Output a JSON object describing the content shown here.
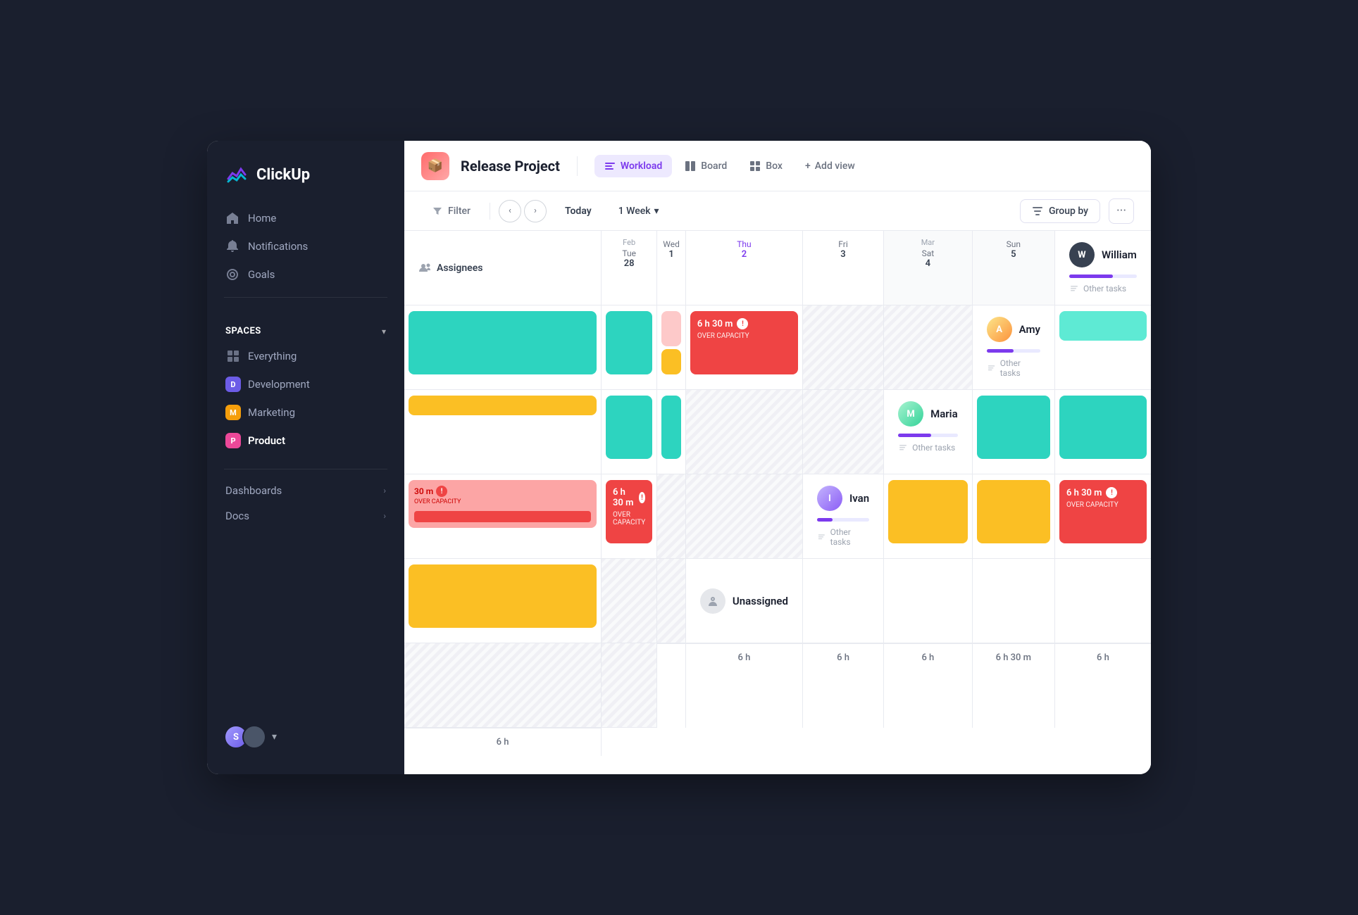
{
  "app": {
    "name": "ClickUp"
  },
  "sidebar": {
    "nav": [
      {
        "id": "home",
        "label": "Home",
        "icon": "home"
      },
      {
        "id": "notifications",
        "label": "Notifications",
        "icon": "bell"
      },
      {
        "id": "goals",
        "label": "Goals",
        "icon": "trophy"
      }
    ],
    "spaces_label": "Spaces",
    "spaces": [
      {
        "id": "everything",
        "label": "Everything",
        "icon": "grid",
        "badge": null
      },
      {
        "id": "development",
        "label": "Development",
        "badge": "D",
        "color": "#6c5ce7"
      },
      {
        "id": "marketing",
        "label": "Marketing",
        "badge": "M",
        "color": "#f59e0b"
      },
      {
        "id": "product",
        "label": "Product",
        "badge": "P",
        "color": "#ec4899",
        "active": true
      }
    ],
    "dashboards_label": "Dashboards",
    "docs_label": "Docs"
  },
  "header": {
    "project_name": "Release Project",
    "views": [
      {
        "id": "workload",
        "label": "Workload",
        "active": true
      },
      {
        "id": "board",
        "label": "Board",
        "active": false
      },
      {
        "id": "box",
        "label": "Box",
        "active": false
      }
    ],
    "add_view_label": "Add view"
  },
  "toolbar": {
    "filter_label": "Filter",
    "today_label": "Today",
    "week_label": "1 Week",
    "group_by_label": "Group by",
    "more_label": "···"
  },
  "calendar": {
    "columns": [
      {
        "id": "feb-tue",
        "month": "Feb",
        "day_name": "Tue",
        "day_num": "28",
        "today": false,
        "weekend": false
      },
      {
        "id": "feb-wed",
        "month": "",
        "day_name": "Wed",
        "day_num": "1",
        "today": false,
        "weekend": false
      },
      {
        "id": "thu",
        "month": "",
        "day_name": "Thu",
        "day_num": "2",
        "today": true,
        "weekend": false
      },
      {
        "id": "fri",
        "month": "",
        "day_name": "Fri",
        "day_num": "3",
        "today": false,
        "weekend": false
      },
      {
        "id": "mar-sat",
        "month": "Mar",
        "day_name": "Sat",
        "day_num": "4",
        "today": false,
        "weekend": true
      },
      {
        "id": "sun",
        "month": "",
        "day_name": "Sun",
        "day_num": "5",
        "today": false,
        "weekend": true
      }
    ],
    "assignees_label": "Assignees"
  },
  "people": [
    {
      "id": "william",
      "name": "William",
      "progress": 65,
      "other_tasks": "Other tasks",
      "days": [
        {
          "type": "green",
          "tall": true
        },
        {
          "type": "green",
          "tall": true
        },
        {
          "type": "peach",
          "tall": true
        },
        {
          "type": "over",
          "label": "6 h 30 m",
          "sub": "OVER CAPACITY"
        },
        {
          "type": "weekend"
        },
        {
          "type": "weekend"
        }
      ]
    },
    {
      "id": "amy",
      "name": "Amy",
      "progress": 50,
      "other_tasks": "Other tasks",
      "days": [
        {
          "type": "small-green"
        },
        {
          "type": "small-orange"
        },
        {
          "type": "green",
          "tall": true
        },
        {
          "type": "green",
          "tall": true
        },
        {
          "type": "weekend"
        },
        {
          "type": "weekend"
        }
      ]
    },
    {
      "id": "maria",
      "name": "Maria",
      "progress": 55,
      "other_tasks": "Other tasks",
      "days": [
        {
          "type": "green",
          "tall": true
        },
        {
          "type": "green",
          "tall": true
        },
        {
          "type": "over-small",
          "label": "30 m",
          "sub": "OVER CAPACITY"
        },
        {
          "type": "over",
          "label": "6 h 30 m",
          "sub": "OVER CAPACITY"
        },
        {
          "type": "weekend"
        },
        {
          "type": "weekend"
        }
      ]
    },
    {
      "id": "ivan",
      "name": "Ivan",
      "progress": 30,
      "other_tasks": "Other tasks",
      "days": [
        {
          "type": "orange",
          "tall": true
        },
        {
          "type": "orange",
          "tall": true
        },
        {
          "type": "over",
          "label": "6 h 30 m",
          "sub": "OVER CAPACITY"
        },
        {
          "type": "orange",
          "tall": true
        },
        {
          "type": "weekend"
        },
        {
          "type": "weekend"
        }
      ]
    }
  ],
  "footer": {
    "hours": [
      "",
      "6 h",
      "6 h",
      "6 h",
      "6 h 30 m",
      "6 h",
      "6 h"
    ]
  },
  "unassigned": {
    "label": "Unassigned"
  }
}
